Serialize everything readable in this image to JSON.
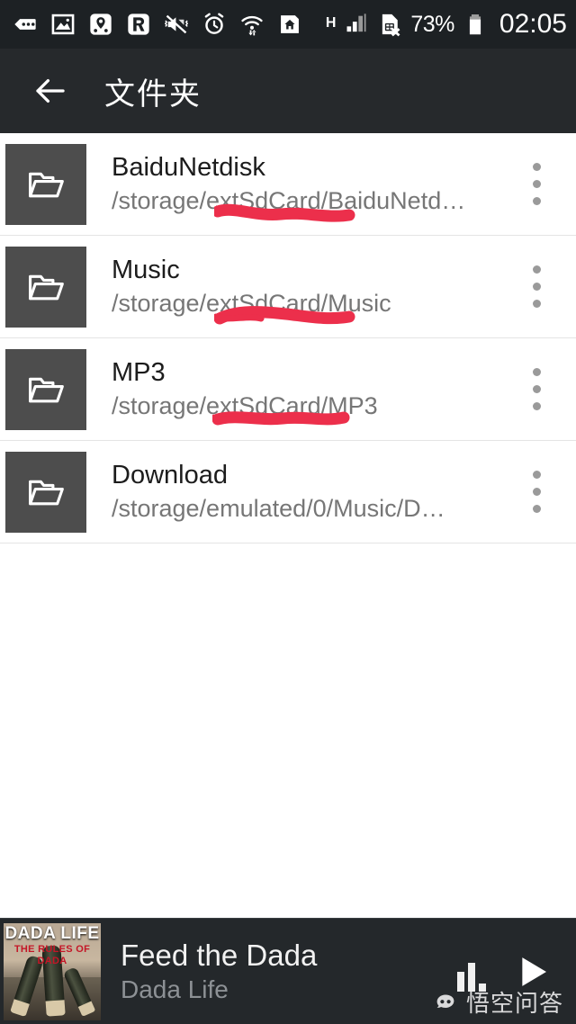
{
  "status_bar": {
    "background": "#1d2124",
    "left_icons": [
      {
        "name": "more-notifications-icon",
        "glyph": "dots-tag"
      },
      {
        "name": "gallery-photo-icon",
        "glyph": "photo"
      },
      {
        "name": "location-pin-icon",
        "glyph": "map-pin"
      },
      {
        "name": "app-r-icon",
        "glyph": "letter-r"
      },
      {
        "name": "vibrate-mute-icon",
        "glyph": "speaker-muted"
      },
      {
        "name": "alarm-clock-icon",
        "glyph": "alarm"
      },
      {
        "name": "wifi-transfer-icon",
        "glyph": "wifi-arrows"
      },
      {
        "name": "home-icon",
        "glyph": "home"
      }
    ],
    "network_type": "H",
    "signal_icon": "signal-bars-icon",
    "sim_icon": "sim-card-disabled-icon",
    "battery_percent": "73%",
    "battery_icon": "battery-icon",
    "clock": "02:05"
  },
  "app_bar": {
    "background": "#26292c",
    "back_icon": "back-arrow-icon",
    "title": "文件夹"
  },
  "folders": [
    {
      "name": "BaiduNetdisk",
      "path": "/storage/extSdCard/BaiduNetd…",
      "icon": "folder-icon",
      "menu_icon": "overflow-menu-icon",
      "annotated": true
    },
    {
      "name": "Music",
      "path": "/storage/extSdCard/Music",
      "icon": "folder-icon",
      "menu_icon": "overflow-menu-icon",
      "annotated": true
    },
    {
      "name": "MP3",
      "path": "/storage/extSdCard/MP3",
      "icon": "folder-icon",
      "menu_icon": "overflow-menu-icon",
      "annotated": true
    },
    {
      "name": "Download",
      "path": "/storage/emulated/0/Music/D…",
      "icon": "folder-icon",
      "menu_icon": "overflow-menu-icon",
      "annotated": false
    }
  ],
  "annotation": {
    "color": "#ec2f4b",
    "style": "hand-drawn-underline"
  },
  "player": {
    "background": "#24282b",
    "album_art": {
      "title": "DADA LIFE",
      "subtitle": "THE RULES OF DADA",
      "name": "album-art"
    },
    "track_title": "Feed the Dada",
    "track_artist": "Dada Life",
    "equalizer_icon": "equalizer-icon",
    "play_icon": "play-icon"
  },
  "watermark": {
    "text": "悟空问答",
    "logo": "wukong-logo-icon"
  },
  "colors": {
    "status_bar": "#1d2124",
    "app_bar": "#26292c",
    "list_bg": "#ffffff",
    "thumb_bg": "#4d4d4d",
    "title_text": "#1c1c1c",
    "path_text": "#767676",
    "annotation_red": "#ec2f4b",
    "player_bg": "#24282b"
  }
}
